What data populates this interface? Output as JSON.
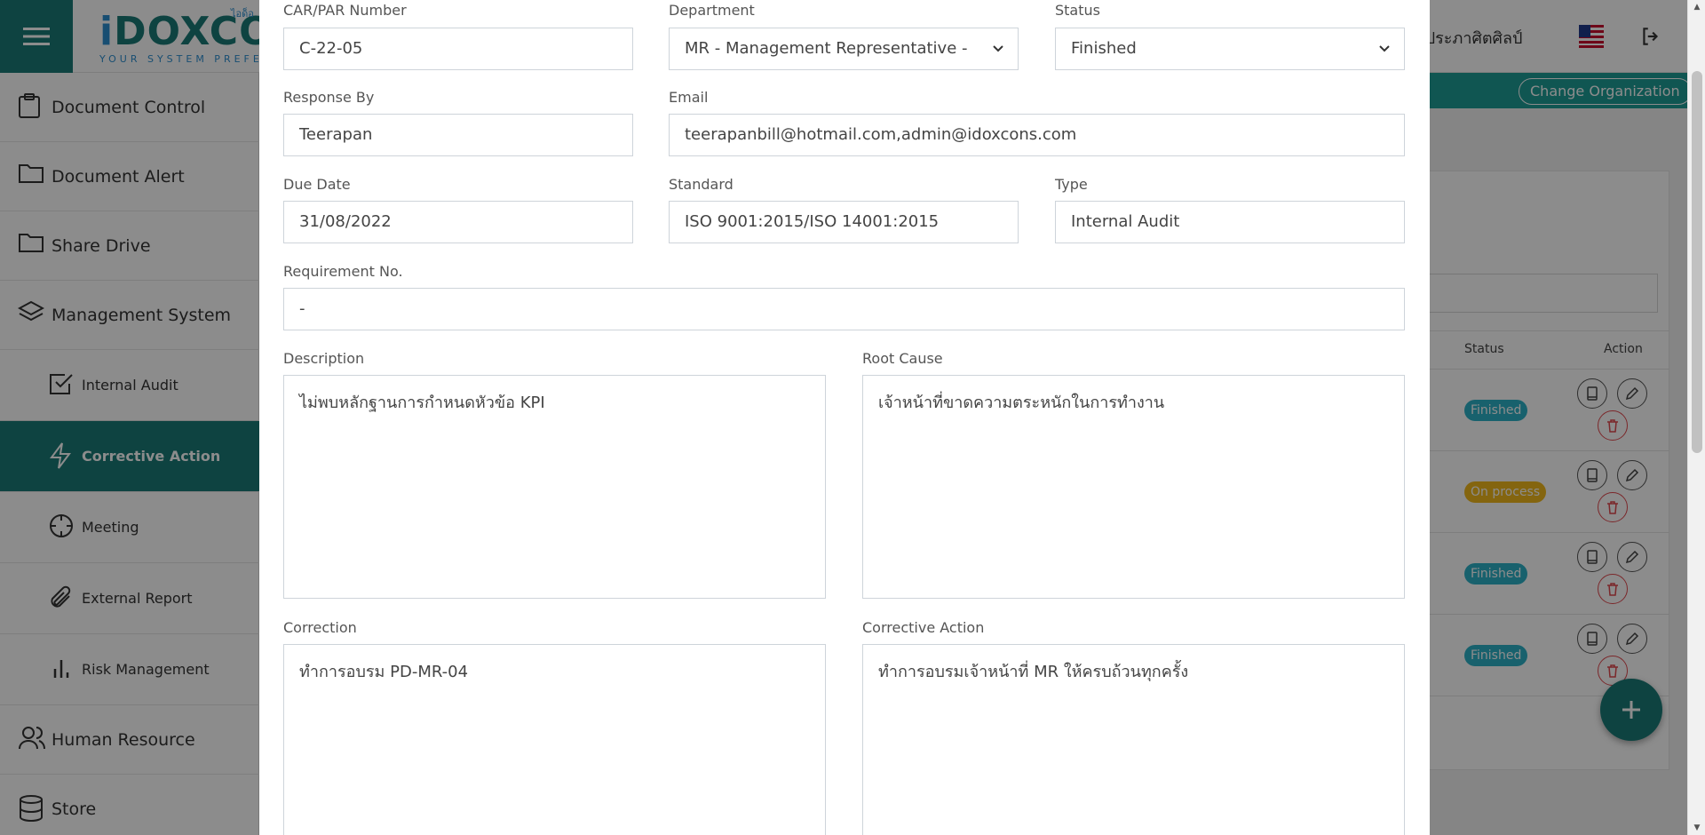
{
  "header": {
    "brand_i": "i",
    "brand_rest": "DOXCON",
    "tagline": "YOUR SYSTEM  PREFERENCE",
    "thai_small": "ไอด็อ",
    "user_name": "ธ์ ประภาศิตศิลป์",
    "change_org_label": "Change Organization"
  },
  "sidebar": {
    "items": [
      {
        "label": "Document Control",
        "icon": "clipboard-icon"
      },
      {
        "label": "Document Alert",
        "icon": "folder-icon"
      },
      {
        "label": "Share Drive",
        "icon": "folder-icon"
      },
      {
        "label": "Management System",
        "icon": "layers-icon"
      },
      {
        "label": "Internal Audit",
        "icon": "check-square-icon"
      },
      {
        "label": "Corrective Action",
        "icon": "lightning-icon"
      },
      {
        "label": "Meeting",
        "icon": "crosshair-icon"
      },
      {
        "label": "External Report",
        "icon": "paperclip-icon"
      },
      {
        "label": "Risk Management",
        "icon": "bar-chart-icon"
      },
      {
        "label": "Human Resource",
        "icon": "users-icon"
      },
      {
        "label": "Store",
        "icon": "database-icon"
      }
    ]
  },
  "table": {
    "status_header": "Status",
    "action_header": "Action",
    "rows": [
      {
        "status": "Finished"
      },
      {
        "status": "On process"
      },
      {
        "status": "Finished"
      },
      {
        "status": "Finished"
      }
    ]
  },
  "form": {
    "car_par_label": "CAR/PAR Number",
    "car_par_value": "C-22-05",
    "department_label": "Department",
    "department_value": "MR - Management Representative -",
    "status_label": "Status",
    "status_value": "Finished",
    "response_by_label": "Response By",
    "response_by_value": "Teerapan",
    "email_label": "Email",
    "email_value": "teerapanbill@hotmail.com,admin@idoxcons.com",
    "due_date_label": "Due Date",
    "due_date_value": "31/08/2022",
    "standard_label": "Standard",
    "standard_value": "ISO 9001:2015/ISO 14001:2015",
    "type_label": "Type",
    "type_value": "Internal Audit",
    "requirement_label": "Requirement No.",
    "requirement_value": "-",
    "description_label": "Description",
    "description_value": "ไม่พบหลักฐานการกำหนดหัวข้อ KPI",
    "root_cause_label": "Root Cause",
    "root_cause_value": "เจ้าหน้าที่ขาดความตระหนักในการทำงาน",
    "correction_label": "Correction",
    "correction_value": "ทำการอบรม PD-MR-04",
    "corrective_action_label": "Corrective Action",
    "corrective_action_value": "ทำการอบรมเจ้าหน้าที่ MR ให้ครบถ้วนทุกครั้ง"
  },
  "colors": {
    "brand_teal": "#1a7b77",
    "finished_badge": "#2cb1c6",
    "on_process_badge": "#f0b81c",
    "delete_red": "#e0484e"
  }
}
